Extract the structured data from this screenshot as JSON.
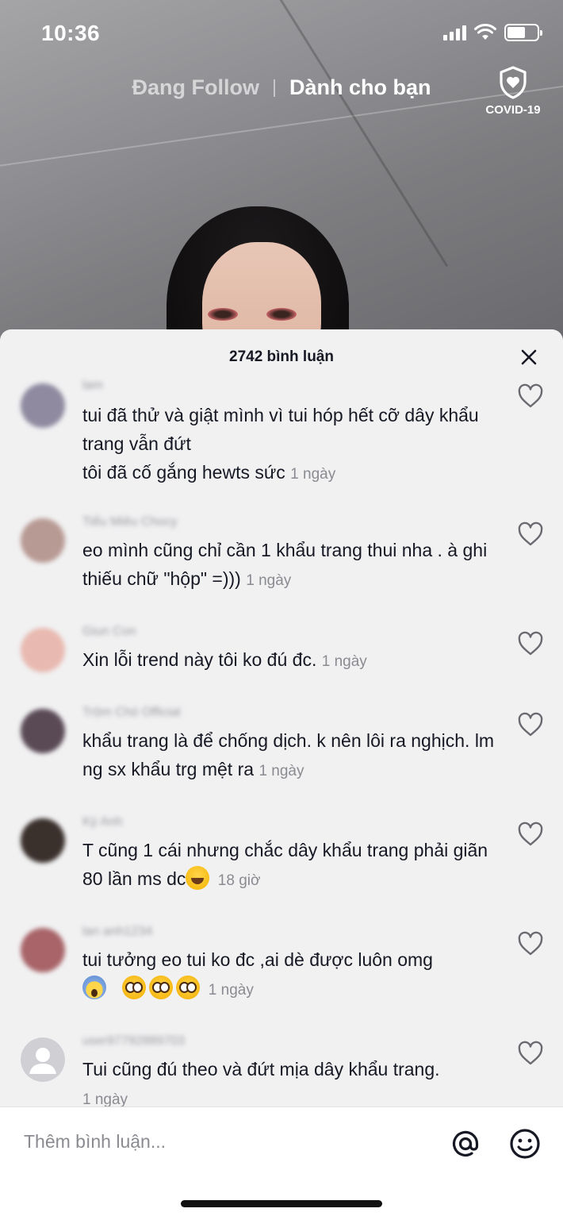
{
  "status_bar": {
    "time": "10:36"
  },
  "top_nav": {
    "tabs": [
      {
        "label": "Đang Follow",
        "active": false
      },
      {
        "label": "Dành cho bạn",
        "active": true
      }
    ],
    "covid_label": "COVID-19"
  },
  "sheet": {
    "comment_count": "2742 bình luận",
    "comments": [
      {
        "username": "lam",
        "text": "tui đã thử và giật mình vì tui hóp hết cỡ dây khẩu trang vẫn đứt\ntôi đã cố gắng hewts sức",
        "time": "1 ngày",
        "avatar_color": "#8f8aa0"
      },
      {
        "username": "Tiểu Miêu Chocy",
        "text": "eo mình cũng chỉ cần 1 khẩu trang thui nha . à ghi thiếu chữ \"hộp\" =)))",
        "time": "1 ngày",
        "avatar_color": "#b89a94"
      },
      {
        "username": "Giun Con",
        "text": "Xin lỗi trend này tôi ko đú đc.",
        "time": "1 ngày",
        "avatar_color": "#e8b9b0"
      },
      {
        "username": "Trộm Chó Official",
        "text": "khẩu trang là để chống dịch. k nên lôi ra nghịch. lm ng sx khẩu trg mệt ra",
        "time": "1 ngày",
        "avatar_color": "#5a4a55"
      },
      {
        "username": "Kỳ Anh",
        "text": "T cũng 1 cái nhưng chắc dây khẩu trang phải giãn 80 lần ms dc",
        "time": "18 giờ",
        "emoji": "laugh",
        "avatar_color": "#3a302c"
      },
      {
        "username": "lan anh1234",
        "text": "tui tưởng eo tui ko đc ,ai dè được luôn omg",
        "time": "1 ngày",
        "emoji_line": [
          "scream",
          "flush",
          "flush",
          "flush"
        ],
        "avatar_color": "#a86468"
      },
      {
        "username": "user97792889703",
        "text": "Tui cũng đú theo và đứt mịa dây khẩu trang.",
        "time": "1 ngày",
        "avatar_color": "#cfcfd4"
      }
    ]
  },
  "input_bar": {
    "placeholder": "Thêm bình luận..."
  },
  "colors": {
    "sheet_bg": "#f1f1f2",
    "text_primary": "#161823",
    "text_secondary": "#8a8b91"
  }
}
